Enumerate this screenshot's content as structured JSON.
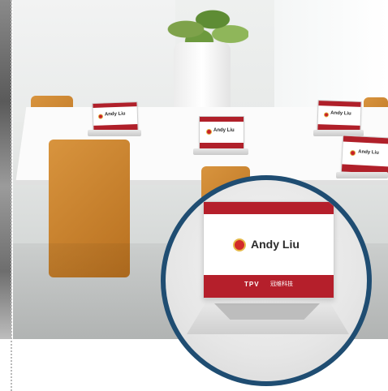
{
  "name_cards": [
    {
      "name": "Andy Liu"
    },
    {
      "name": "Andy Liu"
    },
    {
      "name": "Andy Liu"
    },
    {
      "name": "Andy Liu"
    }
  ],
  "zoomed_card": {
    "name": "Andy Liu",
    "brand_logo": "TPV",
    "brand_logo_subtext": "",
    "brand_name": "冠维科技",
    "brand_tagline": ""
  },
  "colors": {
    "card_red": "#b51f2b",
    "zoom_border": "#1f4d72",
    "chair_orange": "#d8943e"
  }
}
